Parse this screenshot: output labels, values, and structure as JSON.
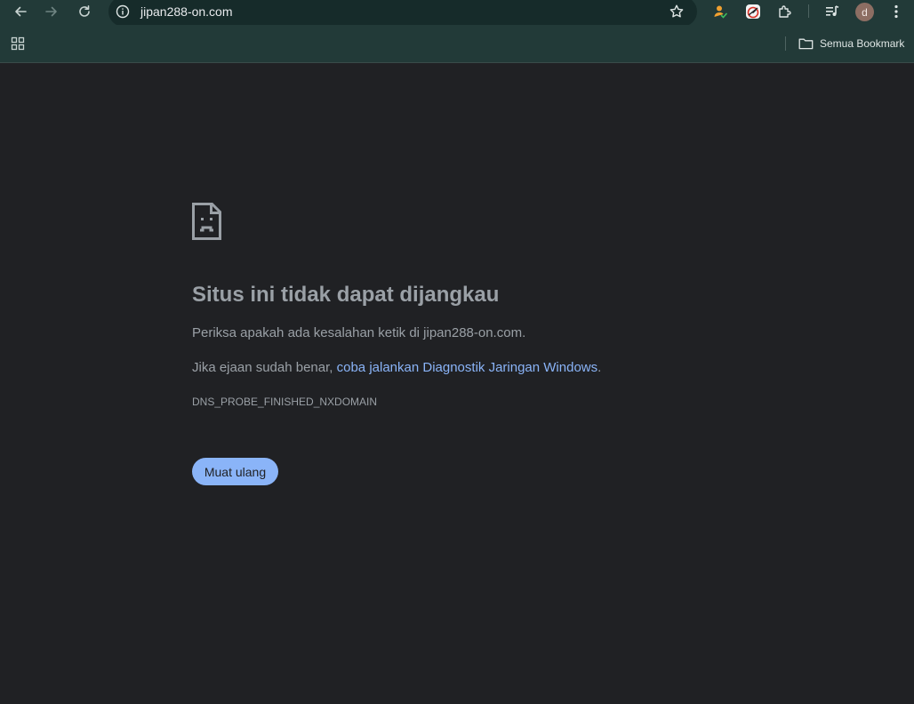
{
  "toolbar": {
    "url": "jipan288-on.com",
    "icons": [
      "back-icon",
      "forward-icon",
      "reload-icon",
      "site-info-icon",
      "bookmark-star-icon",
      "extension-person-icon",
      "extension-gauge-icon",
      "extensions-puzzle-icon",
      "media-controls-icon",
      "menu-icon"
    ],
    "profile_initial": "d"
  },
  "bookmarks_bar": {
    "apps_icon": "apps-grid-icon",
    "all_bookmarks_label": "Semua Bookmark"
  },
  "error_page": {
    "icon": "sad-document-icon",
    "title": "Situs ini tidak dapat dijangkau",
    "line1": "Periksa apakah ada kesalahan ketik di jipan288-on.com.",
    "line2_prefix": "Jika ejaan sudah benar, ",
    "line2_link": "coba jalankan Diagnostik Jaringan Windows",
    "line2_suffix": ".",
    "error_code": "DNS_PROBE_FINISHED_NXDOMAIN",
    "reload_label": "Muat ulang"
  },
  "colors": {
    "toolbar_bg": "#223a38",
    "omnibox_bg": "#162b2a",
    "page_bg": "#202124",
    "text_muted": "#9aa0a6",
    "link": "#8ab4f8",
    "button_bg": "#8ab4f8"
  }
}
